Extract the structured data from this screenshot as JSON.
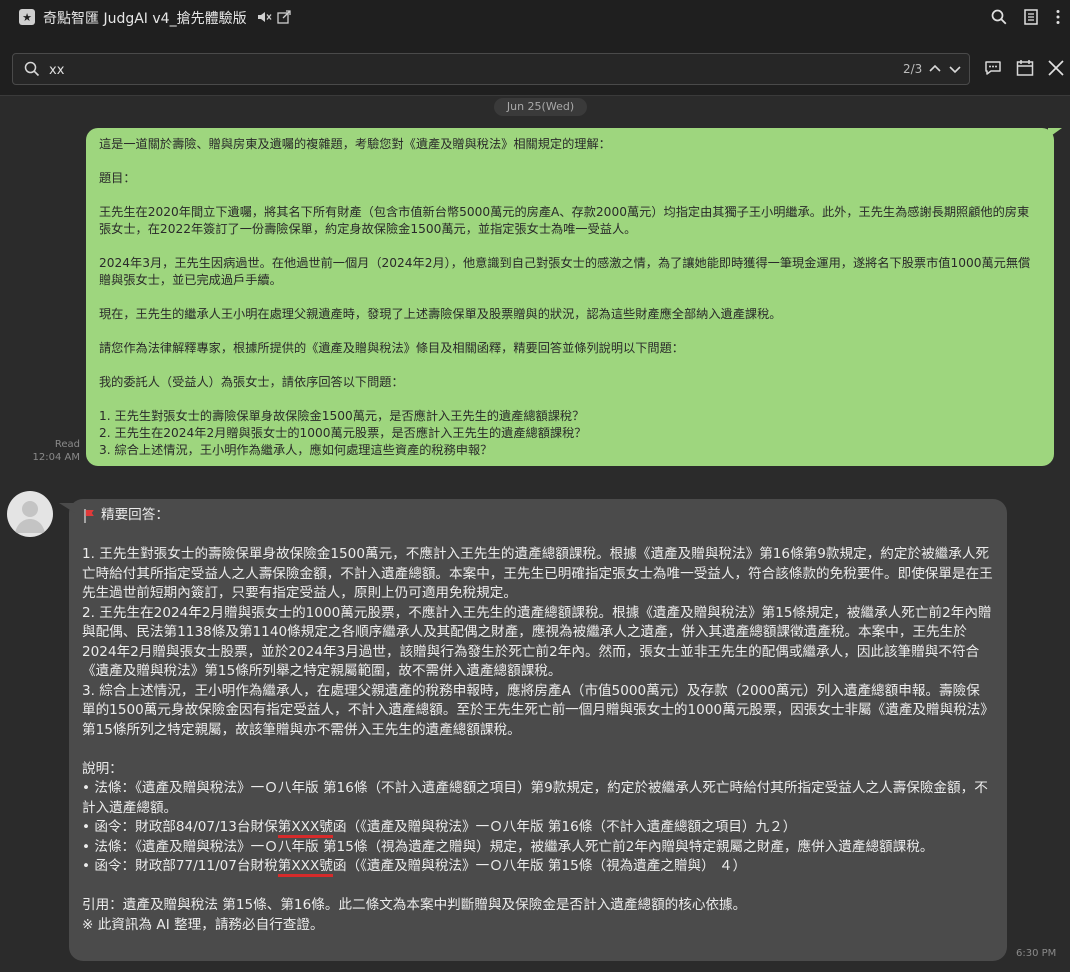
{
  "window": {
    "title": "奇點智匯 JudgAI v4_搶先體驗版",
    "app_badge": "★"
  },
  "search": {
    "value": "xx",
    "placeholder": "",
    "result_counter": "2/3"
  },
  "date_divider": "Jun 25(Wed)",
  "outgoing_message": {
    "read_label": "Read",
    "time": "12:04 AM",
    "paragraphs": [
      "這是一道關於壽險、贈與房東及遺囑的複雜題，考驗您對《遺產及贈與稅法》相關規定的理解：",
      "題目：",
      "王先生在2020年間立下遺囑，將其名下所有財產（包含市值新台幣5000萬元的房產A、存款2000萬元）均指定由其獨子王小明繼承。此外，王先生為感謝長期照顧他的房東張女士，在2022年簽訂了一份壽險保單，約定身故保險金1500萬元，並指定張女士為唯一受益人。",
      "2024年3月，王先生因病過世。在他過世前一個月（2024年2月），他意識到自己對張女士的感激之情，為了讓她能即時獲得一筆現金運用，遂將名下股票市值1000萬元無償贈與張女士，並已完成過戶手續。",
      "現在，王先生的繼承人王小明在處理父親遺產時，發現了上述壽險保單及股票贈與的狀況，認為這些財產應全部納入遺產課稅。",
      "請您作為法律解釋專家，根據所提供的《遺產及贈與稅法》條目及相關函釋，精要回答並條列說明以下問題：",
      "我的委託人（受益人）為張女士，請依序回答以下問題：",
      "1. 王先生對張女士的壽險保單身故保險金1500萬元，是否應計入王先生的遺產總額課稅？\n2. 王先生在2024年2月贈與張女士的1000萬元股票，是否應計入王先生的遺產總額課稅？\n3. 綜合上述情況，王小明作為繼承人，應如何處理這些資產的稅務申報？"
    ]
  },
  "incoming_message": {
    "time": "6:30 PM",
    "heading": "精要回答：",
    "answers": "1. 王先生對張女士的壽險保單身故保險金1500萬元，不應計入王先生的遺產總額課稅。根據《遺產及贈與稅法》第16條第9款規定，約定於被繼承人死亡時給付其所指定受益人之人壽保險金額，不計入遺產總額。本案中，王先生已明確指定張女士為唯一受益人，符合該條款的免稅要件。即使保單是在王先生過世前短期內簽訂，只要有指定受益人，原則上仍可適用免稅規定。\n2. 王先生在2024年2月贈與張女士的1000萬元股票，不應計入王先生的遺產總額課稅。根據《遺產及贈與稅法》第15條規定，被繼承人死亡前2年內贈與配偶、民法第1138條及第1140條規定之各順序繼承人及其配偶之財產，應視為被繼承人之遺產，併入其遺產總額課徵遺產稅。本案中，王先生於2024年2月贈與張女士股票，並於2024年3月過世，該贈與行為發生於死亡前2年內。然而，張女士並非王先生的配偶或繼承人，因此該筆贈與不符合《遺產及贈與稅法》第15條所列舉之特定親屬範圍，故不需併入遺產總額課稅。\n3. 綜合上述情況，王小明作為繼承人，在處理父親遺產的稅務申報時，應將房產A（市值5000萬元）及存款（2000萬元）列入遺產總額申報。壽險保單的1500萬元身故保險金因有指定受益人，不計入遺產總額。至於王先生死亡前一個月贈與張女士的1000萬元股票，因張女士非屬《遺產及贈與稅法》第15條所列之特定親屬，故該筆贈與亦不需併入王先生的遺產總額課稅。",
    "explain_title": "說明：",
    "bullet1": "• 法條：《遺產及贈與稅法》一Ｏ八年版 第16條（不計入遺產總額之項目）第9款規定，約定於被繼承人死亡時給付其所指定受益人之人壽保險金額，不計入遺產總額。",
    "bullet2_pre": "• 函令：財政部84/07/13台財保",
    "bullet2_mark": "第XXX號",
    "bullet2_post": "函（《遺產及贈與稅法》一Ｏ八年版 第16條（不計入遺產總額之項目）九２）",
    "bullet3": "• 法條：《遺產及贈與稅法》一Ｏ八年版 第15條（視為遺產之贈與）規定，被繼承人死亡前2年內贈與特定親屬之財產，應併入遺產總額課稅。",
    "bullet4_pre": "• 函令：財政部77/11/07台財稅",
    "bullet4_mark": "第XXX號",
    "bullet4_post": "函（《遺產及贈與稅法》一Ｏ八年版 第15條（視為遺產之贈與） ４）",
    "citation": "引用：遺產及贈與稅法 第15條、第16條。此二條文為本案中判斷贈與及保險金是否計入遺產總額的核心依據。",
    "disclaimer": "※ 此資訊為 AI 整理，請務必自行查證。"
  },
  "colors": {
    "outgoing_bubble": "#9ed67e",
    "incoming_bubble": "#4b4b4b",
    "background": "#2b2b2b",
    "highlight_underline": "#d62b2b"
  },
  "icons": [
    "app-badge-icon",
    "mute-icon",
    "popout-icon",
    "search-icon",
    "notes-icon",
    "more-icon",
    "chevron-up-icon",
    "chevron-down-icon",
    "chat-bubble-icon",
    "calendar-icon",
    "close-icon",
    "red-flag-icon",
    "avatar-icon"
  ]
}
